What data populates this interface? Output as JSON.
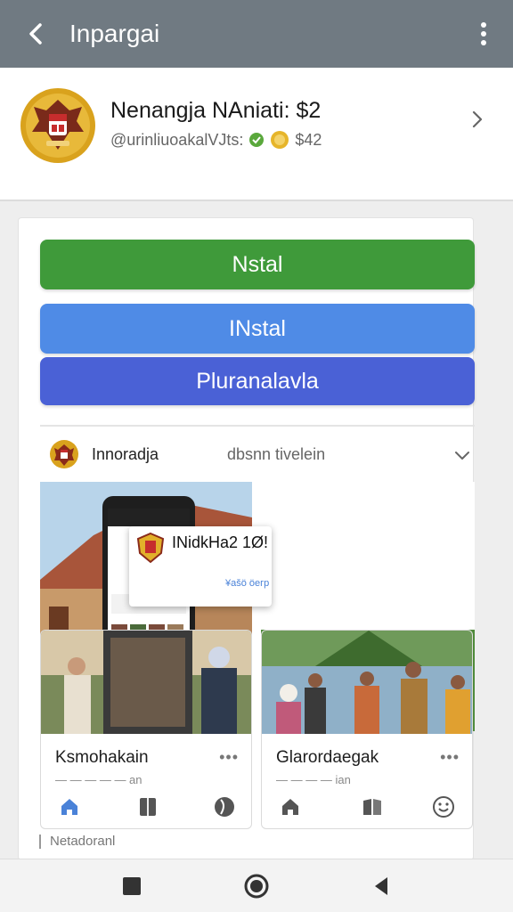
{
  "topbar": {
    "title": "Inpargai"
  },
  "header": {
    "name": "Nenangja NAniati: $2",
    "subtitle": "@urinliuoakalVJts:",
    "count": "$42"
  },
  "buttons": {
    "primary": "Nstal",
    "secondary": "INstal",
    "tertiary": "Pluranalavla"
  },
  "post": {
    "author": "Innoradja",
    "meta": "dbsnn tivelein",
    "overlay_title": "INidkHa2 1Ø!",
    "overlay_sub": "¥ašö öeгр",
    "tiles": [
      {
        "name": "Ksmohakain",
        "sub": "— — — — — an",
        "menu": "•••"
      },
      {
        "name": "Glarordaegak",
        "sub": "— — — — ian",
        "menu": "•••"
      }
    ]
  },
  "footer_note": "Netadoranl",
  "colors": {
    "topbar": "#707a82",
    "green_button": "#3f9a3a",
    "blue_button": "#4f8be6",
    "indigo_button": "#4a61d6",
    "home_icon": "#4a82d8"
  },
  "icons": [
    "back-arrow-icon",
    "overflow-menu-icon",
    "chevron-right-icon",
    "chevron-down-icon",
    "home-icon",
    "book-icon",
    "globe-icon",
    "smiley-icon",
    "square-nav-icon",
    "circle-nav-icon",
    "triangle-back-icon"
  ]
}
